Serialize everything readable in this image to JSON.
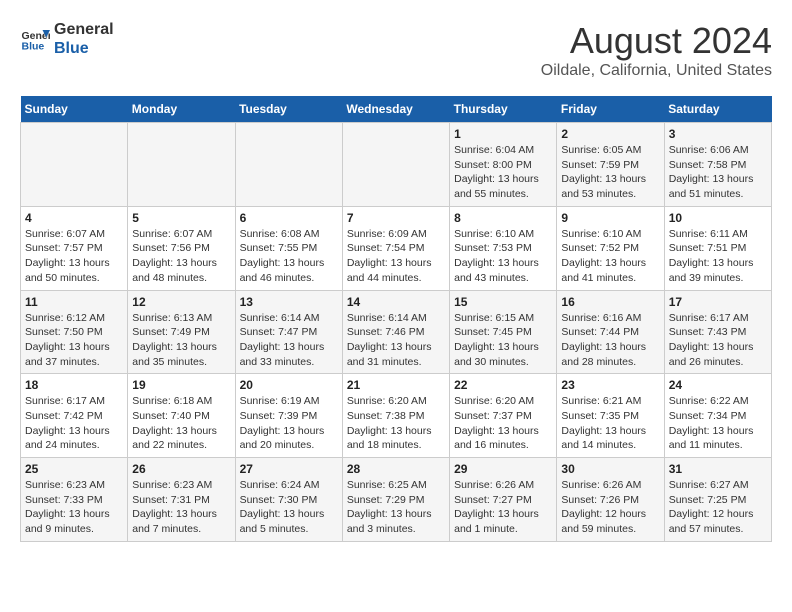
{
  "header": {
    "logo_line1": "General",
    "logo_line2": "Blue",
    "main_title": "August 2024",
    "subtitle": "Oildale, California, United States"
  },
  "weekdays": [
    "Sunday",
    "Monday",
    "Tuesday",
    "Wednesday",
    "Thursday",
    "Friday",
    "Saturday"
  ],
  "weeks": [
    [
      {
        "day": "",
        "info": ""
      },
      {
        "day": "",
        "info": ""
      },
      {
        "day": "",
        "info": ""
      },
      {
        "day": "",
        "info": ""
      },
      {
        "day": "1",
        "info": "Sunrise: 6:04 AM\nSunset: 8:00 PM\nDaylight: 13 hours\nand 55 minutes."
      },
      {
        "day": "2",
        "info": "Sunrise: 6:05 AM\nSunset: 7:59 PM\nDaylight: 13 hours\nand 53 minutes."
      },
      {
        "day": "3",
        "info": "Sunrise: 6:06 AM\nSunset: 7:58 PM\nDaylight: 13 hours\nand 51 minutes."
      }
    ],
    [
      {
        "day": "4",
        "info": "Sunrise: 6:07 AM\nSunset: 7:57 PM\nDaylight: 13 hours\nand 50 minutes."
      },
      {
        "day": "5",
        "info": "Sunrise: 6:07 AM\nSunset: 7:56 PM\nDaylight: 13 hours\nand 48 minutes."
      },
      {
        "day": "6",
        "info": "Sunrise: 6:08 AM\nSunset: 7:55 PM\nDaylight: 13 hours\nand 46 minutes."
      },
      {
        "day": "7",
        "info": "Sunrise: 6:09 AM\nSunset: 7:54 PM\nDaylight: 13 hours\nand 44 minutes."
      },
      {
        "day": "8",
        "info": "Sunrise: 6:10 AM\nSunset: 7:53 PM\nDaylight: 13 hours\nand 43 minutes."
      },
      {
        "day": "9",
        "info": "Sunrise: 6:10 AM\nSunset: 7:52 PM\nDaylight: 13 hours\nand 41 minutes."
      },
      {
        "day": "10",
        "info": "Sunrise: 6:11 AM\nSunset: 7:51 PM\nDaylight: 13 hours\nand 39 minutes."
      }
    ],
    [
      {
        "day": "11",
        "info": "Sunrise: 6:12 AM\nSunset: 7:50 PM\nDaylight: 13 hours\nand 37 minutes."
      },
      {
        "day": "12",
        "info": "Sunrise: 6:13 AM\nSunset: 7:49 PM\nDaylight: 13 hours\nand 35 minutes."
      },
      {
        "day": "13",
        "info": "Sunrise: 6:14 AM\nSunset: 7:47 PM\nDaylight: 13 hours\nand 33 minutes."
      },
      {
        "day": "14",
        "info": "Sunrise: 6:14 AM\nSunset: 7:46 PM\nDaylight: 13 hours\nand 31 minutes."
      },
      {
        "day": "15",
        "info": "Sunrise: 6:15 AM\nSunset: 7:45 PM\nDaylight: 13 hours\nand 30 minutes."
      },
      {
        "day": "16",
        "info": "Sunrise: 6:16 AM\nSunset: 7:44 PM\nDaylight: 13 hours\nand 28 minutes."
      },
      {
        "day": "17",
        "info": "Sunrise: 6:17 AM\nSunset: 7:43 PM\nDaylight: 13 hours\nand 26 minutes."
      }
    ],
    [
      {
        "day": "18",
        "info": "Sunrise: 6:17 AM\nSunset: 7:42 PM\nDaylight: 13 hours\nand 24 minutes."
      },
      {
        "day": "19",
        "info": "Sunrise: 6:18 AM\nSunset: 7:40 PM\nDaylight: 13 hours\nand 22 minutes."
      },
      {
        "day": "20",
        "info": "Sunrise: 6:19 AM\nSunset: 7:39 PM\nDaylight: 13 hours\nand 20 minutes."
      },
      {
        "day": "21",
        "info": "Sunrise: 6:20 AM\nSunset: 7:38 PM\nDaylight: 13 hours\nand 18 minutes."
      },
      {
        "day": "22",
        "info": "Sunrise: 6:20 AM\nSunset: 7:37 PM\nDaylight: 13 hours\nand 16 minutes."
      },
      {
        "day": "23",
        "info": "Sunrise: 6:21 AM\nSunset: 7:35 PM\nDaylight: 13 hours\nand 14 minutes."
      },
      {
        "day": "24",
        "info": "Sunrise: 6:22 AM\nSunset: 7:34 PM\nDaylight: 13 hours\nand 11 minutes."
      }
    ],
    [
      {
        "day": "25",
        "info": "Sunrise: 6:23 AM\nSunset: 7:33 PM\nDaylight: 13 hours\nand 9 minutes."
      },
      {
        "day": "26",
        "info": "Sunrise: 6:23 AM\nSunset: 7:31 PM\nDaylight: 13 hours\nand 7 minutes."
      },
      {
        "day": "27",
        "info": "Sunrise: 6:24 AM\nSunset: 7:30 PM\nDaylight: 13 hours\nand 5 minutes."
      },
      {
        "day": "28",
        "info": "Sunrise: 6:25 AM\nSunset: 7:29 PM\nDaylight: 13 hours\nand 3 minutes."
      },
      {
        "day": "29",
        "info": "Sunrise: 6:26 AM\nSunset: 7:27 PM\nDaylight: 13 hours\nand 1 minute."
      },
      {
        "day": "30",
        "info": "Sunrise: 6:26 AM\nSunset: 7:26 PM\nDaylight: 12 hours\nand 59 minutes."
      },
      {
        "day": "31",
        "info": "Sunrise: 6:27 AM\nSunset: 7:25 PM\nDaylight: 12 hours\nand 57 minutes."
      }
    ]
  ]
}
